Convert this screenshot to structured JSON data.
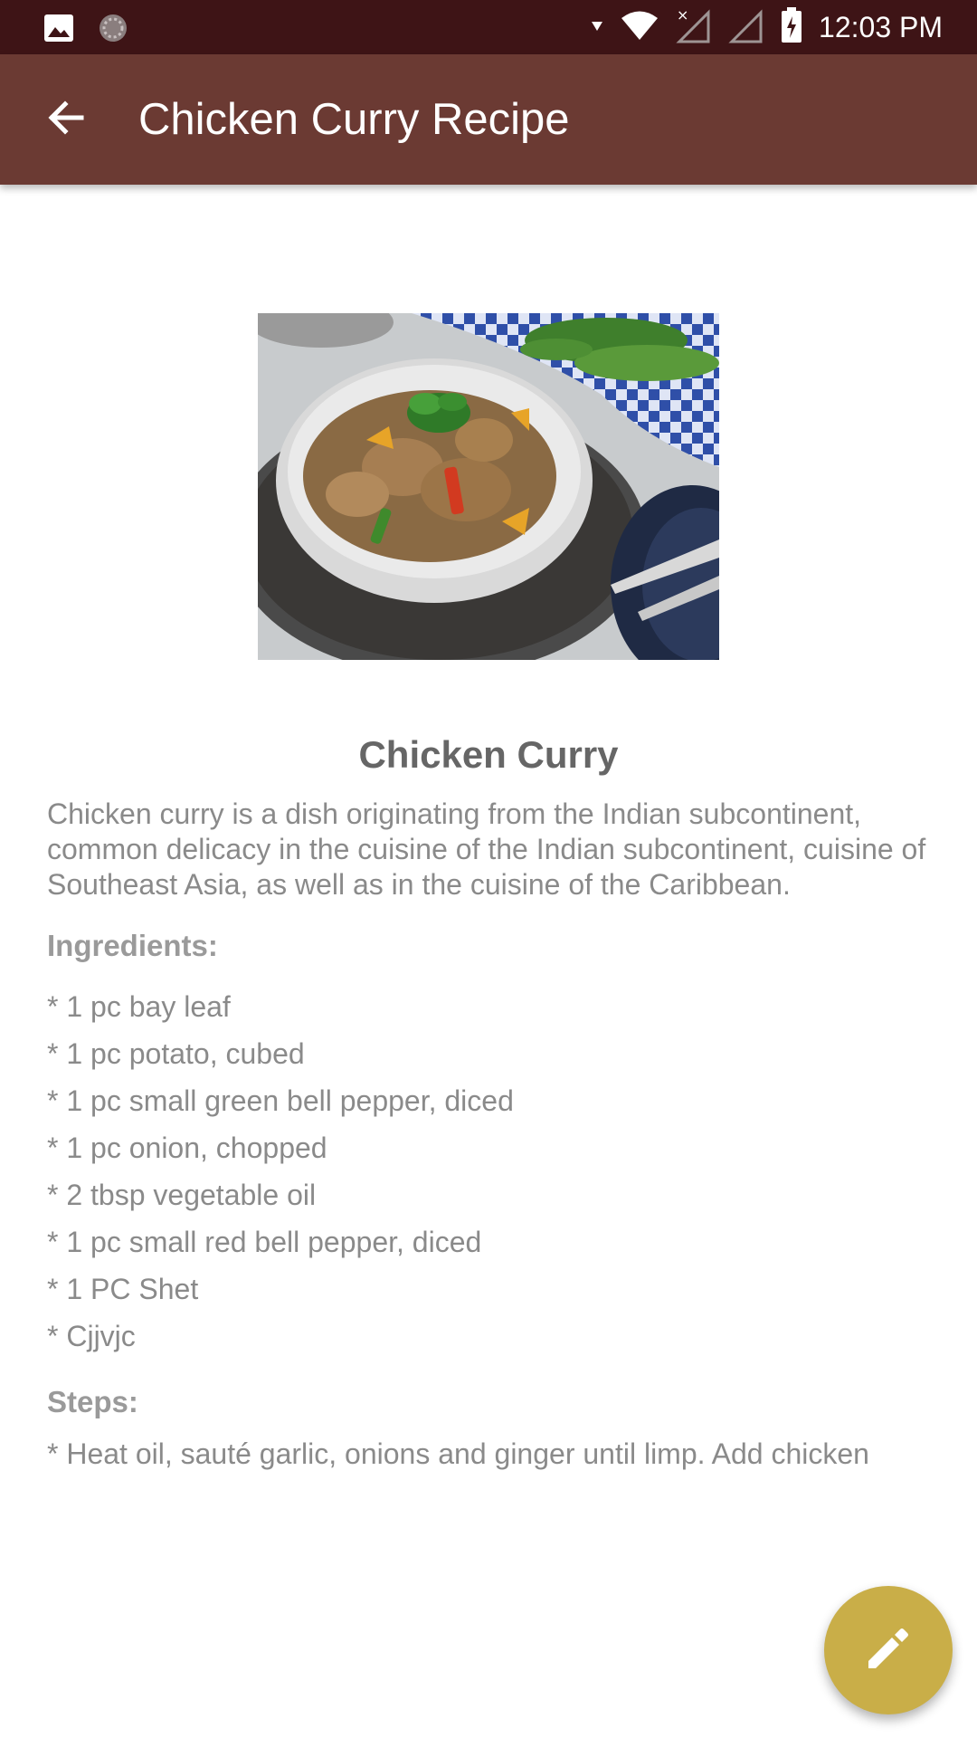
{
  "status_bar": {
    "time": "12:03 PM",
    "icons": [
      "image-notification-icon",
      "sync-notification-icon",
      "wifi-icon",
      "signal-icon",
      "signal-icon",
      "battery-charging-icon"
    ]
  },
  "app_bar": {
    "title": "Chicken Curry Recipe",
    "back_icon": "arrow-back-icon"
  },
  "recipe": {
    "name": "Chicken Curry",
    "description": "Chicken curry is a dish originating from the Indian subcontinent, common delicacy in the cuisine of the Indian subcontinent, cuisine of Southeast Asia, as well as in the cuisine of the Caribbean.",
    "ingredients_label": "Ingredients:",
    "ingredients": [
      "* 1 pc bay leaf",
      "* 1 pc potato, cubed",
      "* 1 pc small green bell pepper, diced",
      "* 1 pc onion, chopped",
      "* 2 tbsp vegetable oil",
      "* 1 pc small red bell pepper, diced",
      "* 1 PC Shet",
      "* Cjjvjc"
    ],
    "steps_label": "Steps:",
    "steps": [
      "* Heat oil, sauté garlic, onions and ginger until limp. Add chicken"
    ]
  },
  "fab": {
    "icon": "edit-pencil-icon"
  },
  "colors": {
    "status_bar": "#3e1416",
    "app_bar": "#6b3a33",
    "fab": "#c9ae48"
  }
}
